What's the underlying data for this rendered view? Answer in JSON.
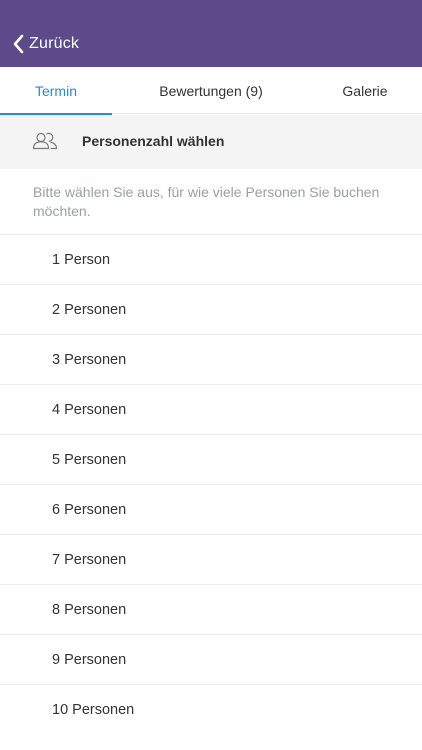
{
  "navbar": {
    "back_label": "Zurück"
  },
  "tabs": [
    {
      "label": "Termin",
      "active": true
    },
    {
      "label": "Bewertungen (9)",
      "active": false
    },
    {
      "label": "Galerie",
      "active": false
    }
  ],
  "section": {
    "icon": "people-icon",
    "title": "Personenzahl wählen"
  },
  "hint": "Bitte wählen Sie aus, für wie viele Personen Sie buchen möchten.",
  "options": [
    "1 Person",
    "2 Personen",
    "3 Personen",
    "4 Personen",
    "5 Personen",
    "6 Personen",
    "7 Personen",
    "8 Personen",
    "9 Personen",
    "10 Personen"
  ],
  "colors": {
    "navbar": "#5d4a8a",
    "accent": "#1e8fd0",
    "section_bg": "#f4f4f5",
    "hint_text": "#9a9ea6"
  }
}
